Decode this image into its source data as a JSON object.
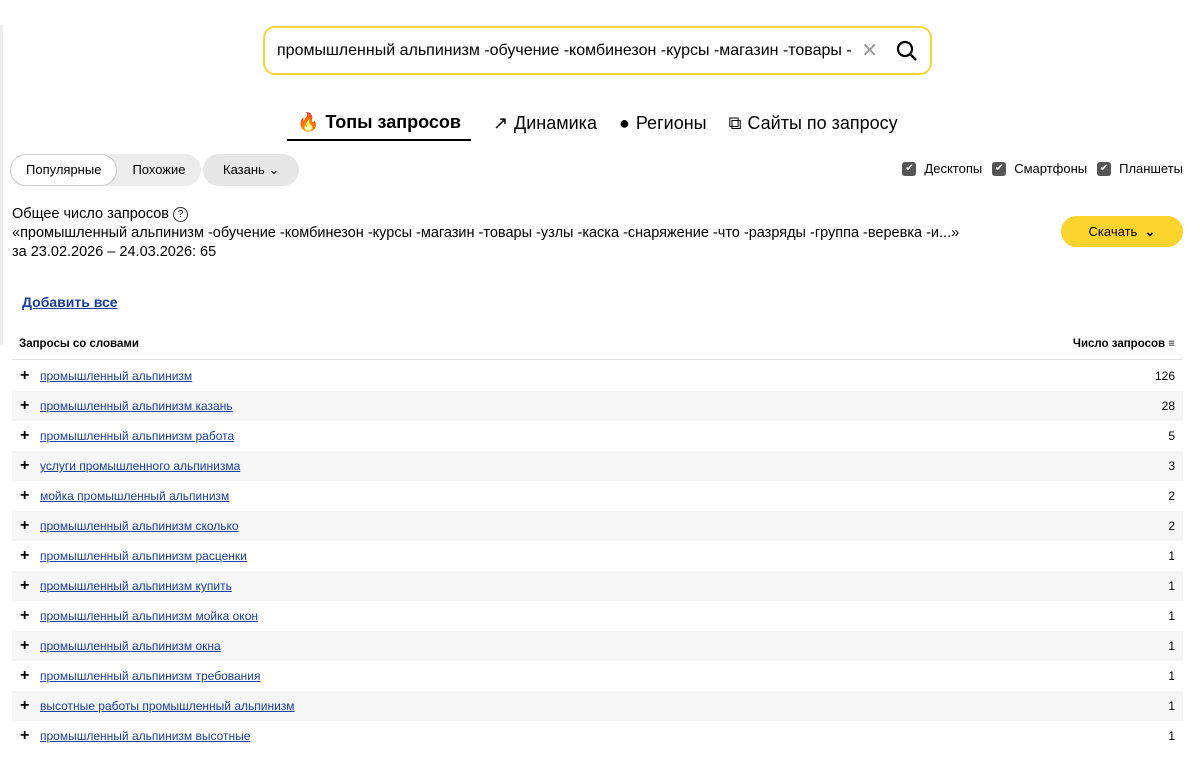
{
  "search": {
    "value": "промышленный альпинизм -обучение -комбинезон -курсы -магазин -товары -узлы"
  },
  "tabs": [
    {
      "label": "Топы запросов",
      "icon": "fire-icon"
    },
    {
      "label": "Динамика",
      "icon": "trend-icon"
    },
    {
      "label": "Регионы",
      "icon": "globe-icon"
    },
    {
      "label": "Сайты по запросу",
      "icon": "external-link-icon"
    }
  ],
  "filters": {
    "popular": "Популярные",
    "similar": "Похожие",
    "region": "Казань"
  },
  "devices": [
    "Десктопы",
    "Смартфоны",
    "Планшеты"
  ],
  "total": {
    "title": "Общее число запросов",
    "query": "«промышленный альпинизм -обучение -комбинезон -курсы -магазин -товары -узлы -каска -снаряжение -что -разряды -группа -веревка -и...»",
    "period": "за 23.02.2026 – 24.03.2026: 65"
  },
  "download": "Скачать",
  "add_all": "Добавить все",
  "table": {
    "col1": "Запросы со словами",
    "col2": "Число запросов",
    "rows": [
      {
        "q": "промышленный альпинизм",
        "n": "126"
      },
      {
        "q": "промышленный альпинизм казань",
        "n": "28"
      },
      {
        "q": "промышленный альпинизм работа",
        "n": "5"
      },
      {
        "q": "услуги промышленного альпинизма",
        "n": "3"
      },
      {
        "q": "мойка промышленный альпинизм",
        "n": "2"
      },
      {
        "q": "промышленный альпинизм сколько",
        "n": "2"
      },
      {
        "q": "промышленный альпинизм расценки",
        "n": "1"
      },
      {
        "q": "промышленный альпинизм купить",
        "n": "1"
      },
      {
        "q": "промышленный альпинизм мойка окон",
        "n": "1"
      },
      {
        "q": "промышленный альпинизм окна",
        "n": "1"
      },
      {
        "q": "промышленный альпинизм требования",
        "n": "1"
      },
      {
        "q": "высотные работы промышленный альпинизм",
        "n": "1"
      },
      {
        "q": "промышленный альпинизм высотные",
        "n": "1"
      }
    ]
  }
}
